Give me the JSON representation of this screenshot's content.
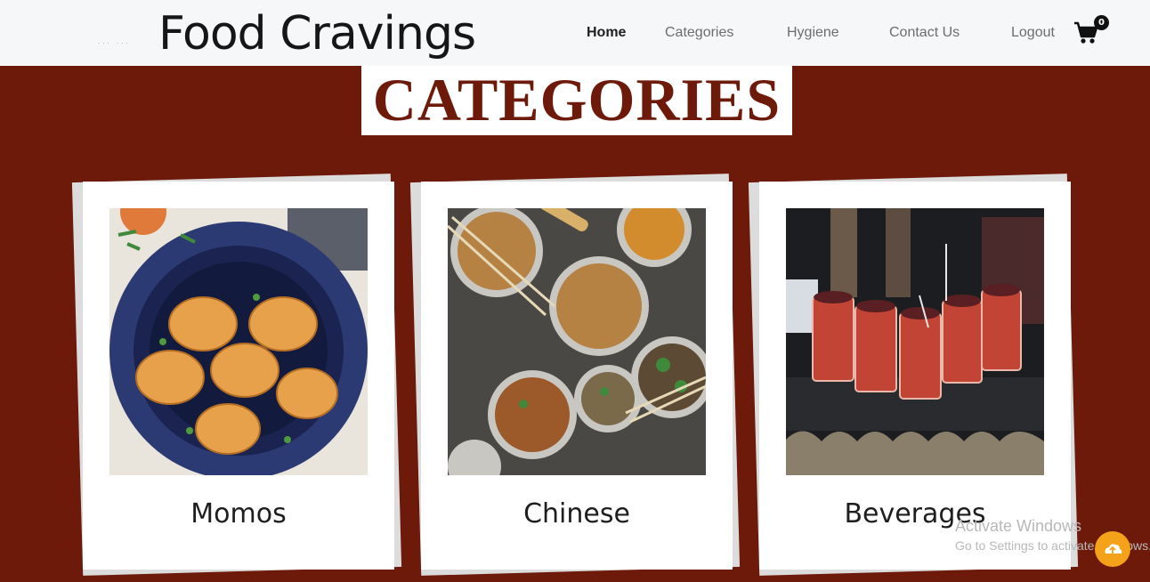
{
  "navbar": {
    "brand": "Food Cravings",
    "logo_text": "··· ···",
    "links": [
      "Home",
      "Categories",
      "Hygiene",
      "Contact Us",
      "Logout"
    ],
    "active_link": "Home",
    "cart_count": "0"
  },
  "page": {
    "heading": "CATEGORIES"
  },
  "cards": [
    {
      "title": "Momos",
      "image": "momos-photo"
    },
    {
      "title": "Chinese",
      "image": "chinese-photo"
    },
    {
      "title": "Beverages",
      "image": "beverages-photo"
    }
  ],
  "watermark": {
    "line1": "Activate Windows",
    "line2": "Go to Settings to activate Windows."
  },
  "colors": {
    "background": "#6e1a0a",
    "navbar": "#f6f7f9",
    "heading_text": "#6e1a0a",
    "fab": "#f5a21b"
  }
}
